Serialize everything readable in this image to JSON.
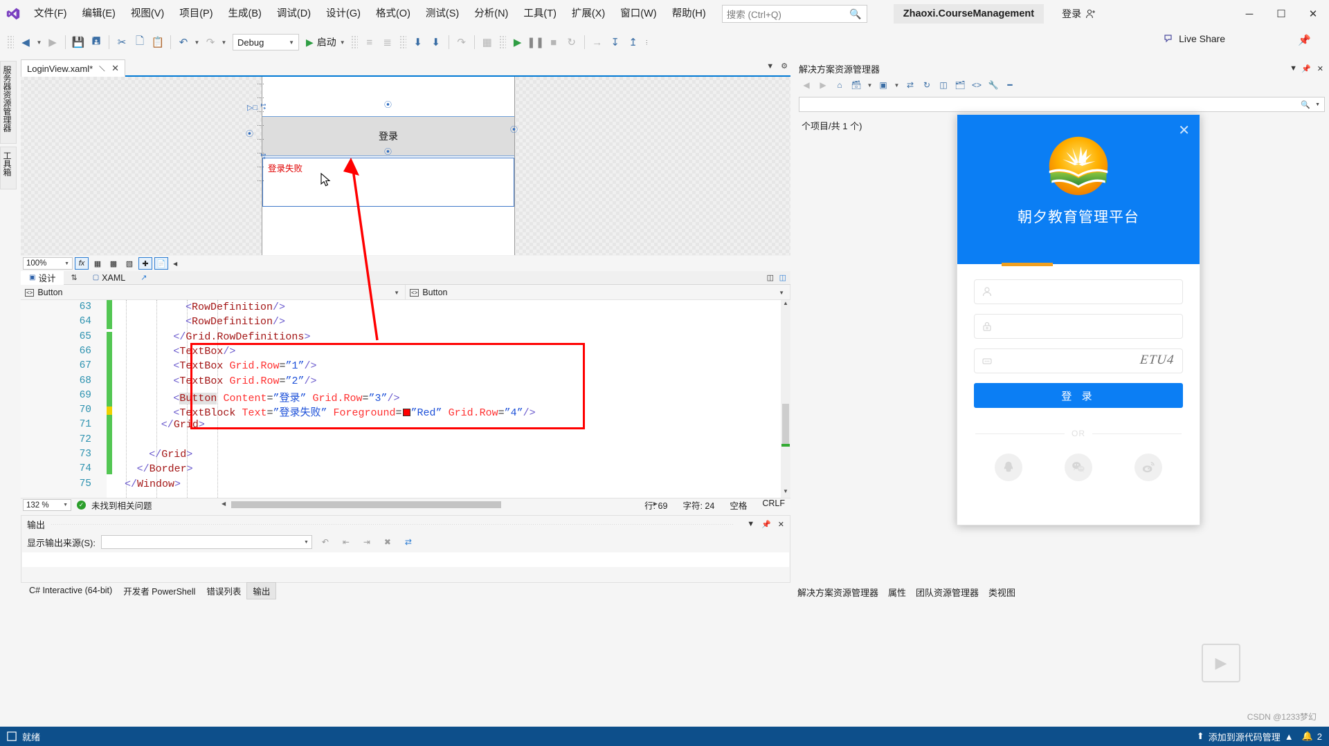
{
  "window": {
    "app_name": "Microsoft Visual Studio",
    "project_chip": "Zhaoxi.CourseManagement",
    "signin_label": "登录",
    "minimize": "─",
    "maximize": "☐",
    "close": "✕"
  },
  "menu": {
    "items": [
      {
        "label": "文件(F)"
      },
      {
        "label": "编辑(E)"
      },
      {
        "label": "视图(V)"
      },
      {
        "label": "项目(P)"
      },
      {
        "label": "生成(B)"
      },
      {
        "label": "调试(D)"
      },
      {
        "label": "设计(G)"
      },
      {
        "label": "格式(O)"
      },
      {
        "label": "测试(S)"
      },
      {
        "label": "分析(N)"
      },
      {
        "label": "工具(T)"
      },
      {
        "label": "扩展(X)"
      },
      {
        "label": "窗口(W)"
      },
      {
        "label": "帮助(H)"
      }
    ],
    "search_placeholder": "搜索 (Ctrl+Q)"
  },
  "toolbar": {
    "config": "Debug",
    "run_label": "启动",
    "liveshare_label": "Live Share"
  },
  "left_tabs": [
    {
      "label": "服务器资源管理器"
    },
    {
      "label": "工具箱"
    }
  ],
  "document": {
    "tab_label": "LoginView.xaml*",
    "pin": "—",
    "close": "✕"
  },
  "designer": {
    "zoom": "100%",
    "button_text": "登录",
    "error_text": "登录失败",
    "tab_design": "设计",
    "tab_xaml": "XAML",
    "crumb_left": "Button",
    "crumb_right": "Button"
  },
  "code": {
    "lines": [
      {
        "num": "63",
        "indent": 20,
        "tokens": [
          {
            "t": "<",
            "c": "k-brk"
          },
          {
            "t": "RowDefinition",
            "c": "k-tag"
          },
          {
            "t": "/>",
            "c": "k-brk"
          }
        ]
      },
      {
        "num": "64",
        "indent": 20,
        "tokens": [
          {
            "t": "<",
            "c": "k-brk"
          },
          {
            "t": "RowDefinition",
            "c": "k-tag"
          },
          {
            "t": "/>",
            "c": "k-brk"
          }
        ]
      },
      {
        "num": "65",
        "indent": 16,
        "tokens": [
          {
            "t": "</",
            "c": "k-brk"
          },
          {
            "t": "Grid.RowDefinitions",
            "c": "k-tag"
          },
          {
            "t": ">",
            "c": "k-brk"
          }
        ]
      },
      {
        "num": "66",
        "indent": 16,
        "tokens": [
          {
            "t": "<",
            "c": "k-brk"
          },
          {
            "t": "TextBox",
            "c": "k-tag"
          },
          {
            "t": "/>",
            "c": "k-brk"
          }
        ]
      },
      {
        "num": "67",
        "indent": 16,
        "tokens": [
          {
            "t": "<",
            "c": "k-brk"
          },
          {
            "t": "TextBox",
            "c": "k-tag"
          },
          {
            "t": " ",
            "c": "k-plain"
          },
          {
            "t": "Grid.Row",
            "c": "k-att"
          },
          {
            "t": "=",
            "c": "k-plain"
          },
          {
            "t": "”1”",
            "c": "k-val"
          },
          {
            "t": "/>",
            "c": "k-brk"
          }
        ]
      },
      {
        "num": "68",
        "indent": 16,
        "tokens": [
          {
            "t": "<",
            "c": "k-brk"
          },
          {
            "t": "TextBox",
            "c": "k-tag"
          },
          {
            "t": " ",
            "c": "k-plain"
          },
          {
            "t": "Grid.Row",
            "c": "k-att"
          },
          {
            "t": "=",
            "c": "k-plain"
          },
          {
            "t": "”2”",
            "c": "k-val"
          },
          {
            "t": "/>",
            "c": "k-brk"
          }
        ]
      },
      {
        "num": "69",
        "indent": 16,
        "tokens": [
          {
            "t": "<",
            "c": "k-brk"
          },
          {
            "t": "Button",
            "c": "k-tag sel-tok"
          },
          {
            "t": " ",
            "c": "k-plain"
          },
          {
            "t": "Content",
            "c": "k-att"
          },
          {
            "t": "=",
            "c": "k-plain"
          },
          {
            "t": "”登录”",
            "c": "k-val"
          },
          {
            "t": " ",
            "c": "k-plain"
          },
          {
            "t": "Grid.Row",
            "c": "k-att"
          },
          {
            "t": "=",
            "c": "k-plain"
          },
          {
            "t": "”3”",
            "c": "k-val"
          },
          {
            "t": "/>",
            "c": "k-brk"
          }
        ]
      },
      {
        "num": "70",
        "indent": 16,
        "tokens": [
          {
            "t": "<",
            "c": "k-brk"
          },
          {
            "t": "TextBlock",
            "c": "k-tag"
          },
          {
            "t": " ",
            "c": "k-plain"
          },
          {
            "t": "Text",
            "c": "k-att"
          },
          {
            "t": "=",
            "c": "k-plain"
          },
          {
            "t": "”登录失败”",
            "c": "k-val"
          },
          {
            "t": " ",
            "c": "k-plain"
          },
          {
            "t": "Foreground",
            "c": "k-att"
          },
          {
            "t": "=",
            "c": "k-plain"
          },
          {
            "t": "@SWATCH@",
            "c": "swatch"
          },
          {
            "t": "”Red”",
            "c": "k-val"
          },
          {
            "t": " ",
            "c": "k-plain"
          },
          {
            "t": "Grid.Row",
            "c": "k-att"
          },
          {
            "t": "=",
            "c": "k-plain"
          },
          {
            "t": "”4”",
            "c": "k-val"
          },
          {
            "t": "/>",
            "c": "k-brk"
          }
        ]
      },
      {
        "num": "71",
        "indent": 12,
        "tokens": [
          {
            "t": "</",
            "c": "k-brk"
          },
          {
            "t": "Grid",
            "c": "k-tag"
          },
          {
            "t": ">",
            "c": "k-brk"
          }
        ]
      },
      {
        "num": "72",
        "indent": 0,
        "tokens": []
      },
      {
        "num": "73",
        "indent": 8,
        "tokens": [
          {
            "t": "</",
            "c": "k-brk"
          },
          {
            "t": "Grid",
            "c": "k-tag"
          },
          {
            "t": ">",
            "c": "k-brk"
          }
        ]
      },
      {
        "num": "74",
        "indent": 4,
        "tokens": [
          {
            "t": "</",
            "c": "k-brk"
          },
          {
            "t": "Border",
            "c": "k-tag"
          },
          {
            "t": ">",
            "c": "k-brk"
          }
        ]
      },
      {
        "num": "75",
        "indent": 0,
        "tokens": [
          {
            "t": "</",
            "c": "k-brk"
          },
          {
            "t": "Window",
            "c": "k-tag"
          },
          {
            "t": ">",
            "c": "k-brk"
          }
        ]
      }
    ]
  },
  "editor_status": {
    "zoom": "132 %",
    "issues": "未找到相关问题",
    "line": "行: 69",
    "col": "字符: 24",
    "space": "空格",
    "eol": "CRLF"
  },
  "output": {
    "title": "输出",
    "source_label": "显示输出来源(S):",
    "source_value": "",
    "tabs": [
      {
        "label": "C# Interactive (64-bit)",
        "active": false
      },
      {
        "label": "开发者 PowerShell",
        "active": false
      },
      {
        "label": "错误列表",
        "active": false
      },
      {
        "label": "输出",
        "active": true
      }
    ]
  },
  "solution_explorer": {
    "title": "解决方案资源管理器",
    "search_placeholder": "",
    "count_text": "个项目/共 1 个)"
  },
  "right_dock_tabs": [
    {
      "label": "解决方案资源管理器"
    },
    {
      "label": "属性"
    },
    {
      "label": "团队资源管理器"
    },
    {
      "label": "类视图"
    }
  ],
  "login_dialog": {
    "title": "朝夕教育管理平台",
    "close": "✕",
    "username_placeholder": "",
    "password_placeholder": "",
    "captcha_placeholder": "",
    "captcha_text": "ETU4",
    "login_button": "登 录",
    "or_text": "OR",
    "socials": [
      {
        "name": "qq-icon"
      },
      {
        "name": "wechat-icon"
      },
      {
        "name": "weibo-icon"
      }
    ]
  },
  "statusbar": {
    "ready": "就绪",
    "source_control": "添加到源代码管理",
    "notification_count": "2"
  },
  "watermark": "CSDN @1233梦幻",
  "colors": {
    "accent": "#0b7ef4",
    "status_bar": "#0d4f8b",
    "annotation": "#ff0000",
    "error_text": "#e00000",
    "vs_tab_underline": "#0078d4"
  }
}
